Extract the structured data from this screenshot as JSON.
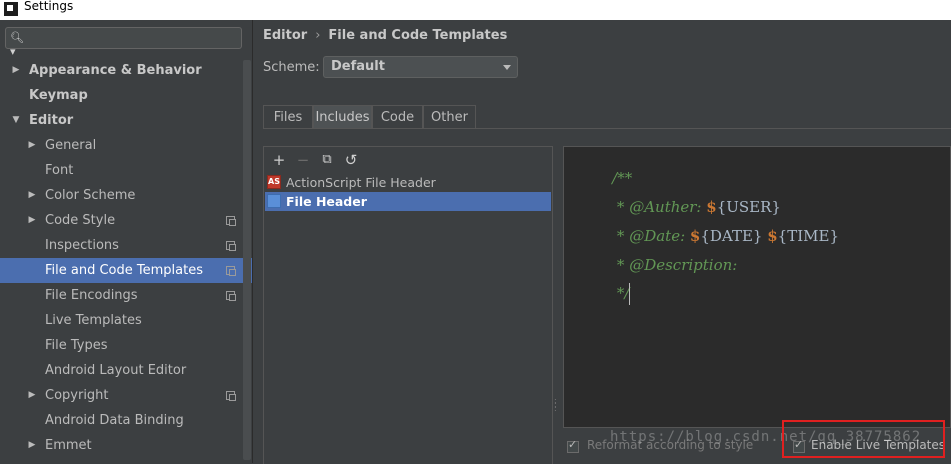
{
  "window": {
    "title": "Settings"
  },
  "search": {
    "placeholder": "",
    "icon": "search-icon"
  },
  "sidebar": {
    "items": [
      {
        "label": "Appearance & Behavior",
        "level": 0,
        "arrow": "▶",
        "icon": false
      },
      {
        "label": "Keymap",
        "level": 0,
        "arrow": "",
        "icon": false
      },
      {
        "label": "Editor",
        "level": 0,
        "arrow": "▼",
        "icon": false
      },
      {
        "label": "General",
        "level": 1,
        "arrow": "▶",
        "icon": false
      },
      {
        "label": "Font",
        "level": 1,
        "arrow": "",
        "icon": false
      },
      {
        "label": "Color Scheme",
        "level": 1,
        "arrow": "▶",
        "icon": false
      },
      {
        "label": "Code Style",
        "level": 1,
        "arrow": "▶",
        "icon": true
      },
      {
        "label": "Inspections",
        "level": 1,
        "arrow": "",
        "icon": true
      },
      {
        "label": "File and Code Templates",
        "level": 1,
        "arrow": "",
        "icon": true,
        "selected": true
      },
      {
        "label": "File Encodings",
        "level": 1,
        "arrow": "",
        "icon": true
      },
      {
        "label": "Live Templates",
        "level": 1,
        "arrow": "",
        "icon": false
      },
      {
        "label": "File Types",
        "level": 1,
        "arrow": "",
        "icon": false
      },
      {
        "label": "Android Layout Editor",
        "level": 1,
        "arrow": "",
        "icon": false
      },
      {
        "label": "Copyright",
        "level": 1,
        "arrow": "▶",
        "icon": true
      },
      {
        "label": "Android Data Binding",
        "level": 1,
        "arrow": "",
        "icon": false
      },
      {
        "label": "Emmet",
        "level": 1,
        "arrow": "▶",
        "icon": false
      }
    ]
  },
  "breadcrumb": {
    "parent": "Editor",
    "separator": "›",
    "current": "File and Code Templates"
  },
  "scheme": {
    "label": "Scheme:",
    "value": "Default"
  },
  "tabs": [
    {
      "label": "Files",
      "active": false
    },
    {
      "label": "Includes",
      "active": true
    },
    {
      "label": "Code",
      "active": false
    },
    {
      "label": "Other",
      "active": false
    }
  ],
  "toolbar": {
    "add": "+",
    "remove": "−",
    "copy": "⧉",
    "reset": "↺"
  },
  "templates": [
    {
      "label": "ActionScript File Header",
      "icon": "actionscript-file-icon",
      "selected": false
    },
    {
      "label": "File Header",
      "icon": "file-header-icon",
      "selected": true
    }
  ],
  "editor": {
    "line1": "/**",
    "line2_prefix": " * ",
    "line2_tag": "@Auther:",
    "line2_dollar": "$",
    "line2_var": "{USER}",
    "line3_prefix": " * ",
    "line3_tag": "@Date:",
    "line3_dollar1": "$",
    "line3_var1": "{DATE}",
    "line3_dollar2": "$",
    "line3_var2": "{TIME}",
    "line4_prefix": " * ",
    "line4_tag": "@Description:",
    "line5": " */"
  },
  "options": {
    "reformat_label": "Reformat according to style",
    "live_templates_label": "Enable Live Templates"
  },
  "watermark": "https://blog.csdn.net/qq_38775862",
  "colors": {
    "accent": "#4b6eaf",
    "highlight": "#e02020"
  }
}
